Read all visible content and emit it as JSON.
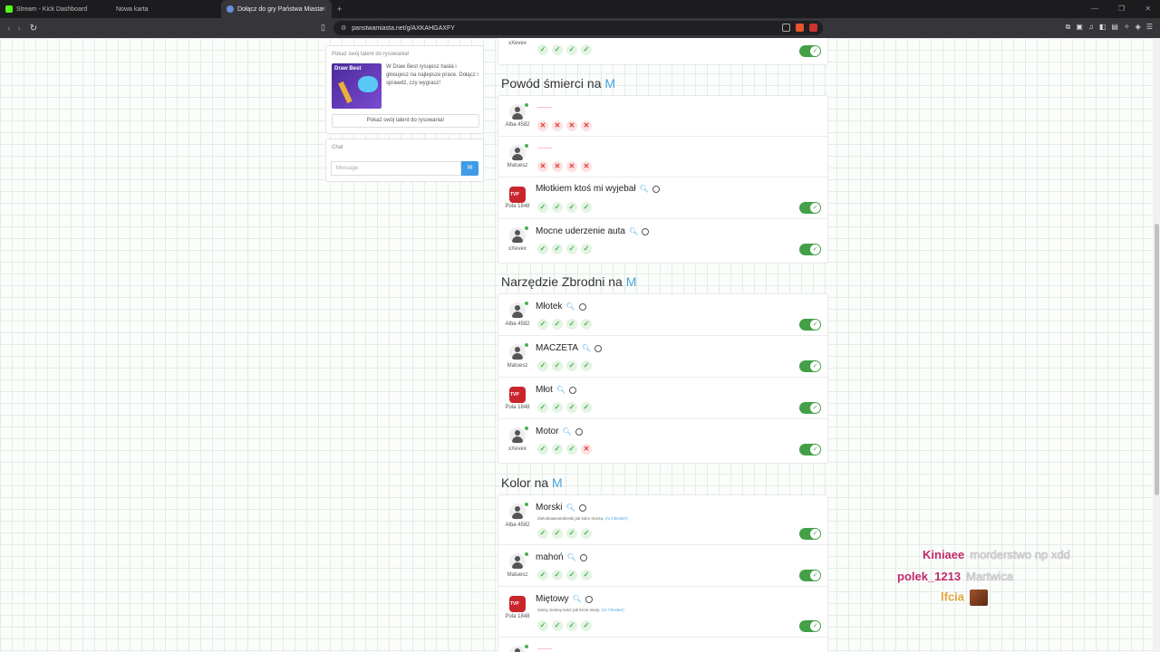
{
  "browser": {
    "tabs": [
      {
        "label": "Stream - Kick Dashboard"
      },
      {
        "label": "Nowa karta"
      },
      {
        "label": "Dołącz do gry Państwa Miasta"
      }
    ],
    "url": "panstwamiasta.net/g/AXKAHGAXFY"
  },
  "sidebar": {
    "promo_title": "Pokaż swój talent do rysowania!",
    "promo_image_label": "Draw Best",
    "promo_text": "W Draw Best rysujesz hasła i głosujesz na najlepsze prace. Dołącz i sprawdź, czy wygrasz!",
    "promo_button": "Pokaż swój talent do rysowania!",
    "chat_title": "Chat",
    "chat_placeholder": "Message"
  },
  "top_partial": {
    "user": "xXevex"
  },
  "categories": [
    {
      "title": "Powód śmierci na",
      "letter": "M",
      "answers": [
        {
          "user": "Alba 4582",
          "word": "",
          "votes": [
            "no",
            "no",
            "no",
            "no"
          ],
          "accepted": false
        },
        {
          "user": "Matuesz",
          "word": "",
          "votes": [
            "no",
            "no",
            "no",
            "no"
          ],
          "accepted": false
        },
        {
          "user": "Pola 1848",
          "word": "Młotkiem ktoś mi wyjebał",
          "votes": [
            "ok",
            "ok",
            "ok",
            "ok"
          ],
          "accepted": true
        },
        {
          "user": "xXevex",
          "word": "Mocne uderzenie auta",
          "votes": [
            "ok",
            "ok",
            "ok",
            "ok"
          ],
          "accepted": true
        }
      ]
    },
    {
      "title": "Narzędzie Zbrodni na",
      "letter": "M",
      "answers": [
        {
          "user": "Alba 4582",
          "word": "Młotek",
          "votes": [
            "ok",
            "ok",
            "ok",
            "ok"
          ],
          "accepted": true
        },
        {
          "user": "Matuesz",
          "word": "MACZETA",
          "votes": [
            "ok",
            "ok",
            "ok",
            "ok"
          ],
          "accepted": true
        },
        {
          "user": "Pola 1848",
          "word": "Młot",
          "votes": [
            "ok",
            "ok",
            "ok",
            "ok"
          ],
          "accepted": true
        },
        {
          "user": "xXevex",
          "word": "Motor",
          "votes": [
            "ok",
            "ok",
            "ok",
            "no"
          ],
          "accepted": true
        }
      ]
    },
    {
      "title": "Kolor na",
      "letter": "M",
      "answers": [
        {
          "user": "Alba 4582",
          "word": "Morski",
          "note": "Zielonkawoniebieski jak kolor morza.",
          "note_ai": "(AI Checker)",
          "votes": [
            "ok",
            "ok",
            "ok",
            "ok"
          ],
          "accepted": true
        },
        {
          "user": "Matuesz",
          "word": "mahoń",
          "votes": [
            "ok",
            "ok",
            "ok",
            "ok"
          ],
          "accepted": true
        },
        {
          "user": "Pola 1848",
          "word": "Miętowy",
          "note": "Jasny zielony kolor jak liście mięty.",
          "note_ai": "(AI Checker)",
          "votes": [
            "ok",
            "ok",
            "ok",
            "ok"
          ],
          "accepted": true
        }
      ]
    }
  ],
  "stream_chat": [
    {
      "user": "Kiniaee",
      "message": "morderstwo np xdd",
      "color": "#c02a6a"
    },
    {
      "user": "polek_1213",
      "message": "Martwica",
      "color": "#c02a6a"
    },
    {
      "user": "lfcia",
      "message": "",
      "emote": "emote",
      "color": "#e0a63a"
    }
  ]
}
